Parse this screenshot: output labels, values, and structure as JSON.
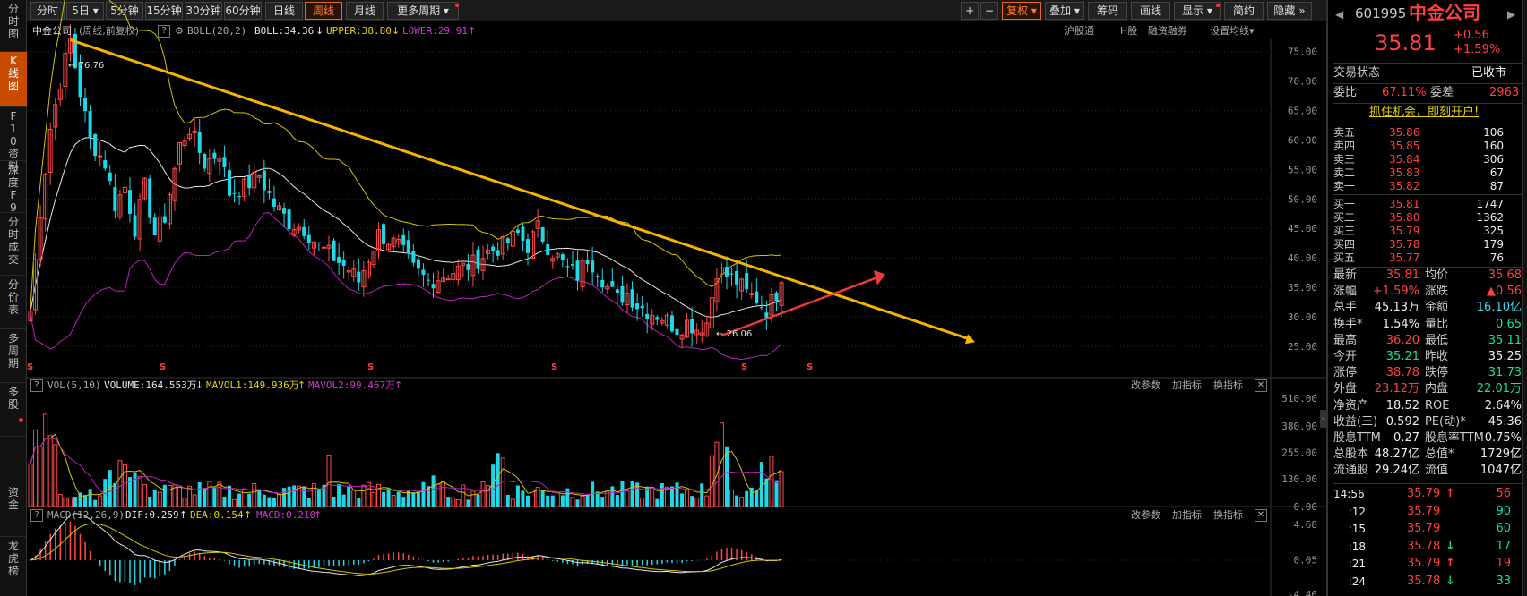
{
  "left_nav": {
    "items": [
      {
        "label": "分时图"
      },
      {
        "label": "K线图"
      },
      {
        "label": "F10资料"
      },
      {
        "label": "深度F9"
      },
      {
        "label": "分时成交"
      },
      {
        "label": "分价表"
      },
      {
        "label": "多周期"
      },
      {
        "label": "多股"
      },
      {
        "label": "资金"
      },
      {
        "label": "龙虎榜"
      }
    ],
    "active": "K线图"
  },
  "toolbar": {
    "periods": [
      "分时",
      "5日",
      "5分钟",
      "15分钟",
      "30分钟",
      "60分钟",
      "日线",
      "周线",
      "月线",
      "更多周期"
    ],
    "active_period": "周线",
    "right_buttons": {
      "plus": "+",
      "minus": "−",
      "fuquan": "复权",
      "overlay": "叠加",
      "chips": "筹码",
      "draw": "画线",
      "display": "显示",
      "simple": "简约",
      "hide": "隐藏"
    }
  },
  "kline_panel": {
    "stock_name": "中金公司",
    "period_note": "(周线,前复权)",
    "indicator": "BOLL(20,2)",
    "boll": "BOLL:34.36",
    "upper": "UPPER:38.80",
    "lower": "LOWER:29.91",
    "links": [
      "沪股通",
      "H股",
      "融资融券",
      "设置均线"
    ],
    "high_label": "76.76",
    "low_label": "26.06",
    "s_markers": [
      "S",
      "S",
      "S",
      "S",
      "S",
      "S"
    ],
    "y_ticks": [
      "75.00",
      "70.00",
      "65.00",
      "60.00",
      "55.00",
      "50.00",
      "45.00",
      "40.00",
      "35.00",
      "30.00",
      "25.00"
    ]
  },
  "vol_panel": {
    "title": "VOL(5,10)",
    "volume": "VOLUME:164.553万",
    "mavol1": "MAVOL1:149.936万",
    "mavol2": "MAVOL2:99.467万",
    "buttons": [
      "改参数",
      "加指标",
      "换指标"
    ],
    "y_ticks": [
      "510.00",
      "380.00",
      "255.00",
      "130.00",
      "0.00"
    ]
  },
  "macd_panel": {
    "title": "MACD(12,26,9)",
    "dif": "DIF:0.259",
    "dea": "DEA:0.154",
    "macd": "MACD:0.210",
    "buttons": [
      "改参数",
      "加指标",
      "换指标"
    ],
    "y_ticks": [
      "4.68",
      "0.05",
      "-4.46"
    ]
  },
  "quote": {
    "code": "601995",
    "name": "中金公司",
    "price": "35.81",
    "change": "+0.56",
    "change_pct": "+1.59%",
    "trade_state_label": "交易状态",
    "trade_state": "已收市",
    "weibi_label": "委比",
    "weibi": "67.11%",
    "weicha_label": "委差",
    "weicha": "2963",
    "promo": "抓住机会，即刻开户!",
    "asks": [
      {
        "label": "卖五",
        "price": "35.86",
        "vol": "106"
      },
      {
        "label": "卖四",
        "price": "35.85",
        "vol": "160"
      },
      {
        "label": "卖三",
        "price": "35.84",
        "vol": "306"
      },
      {
        "label": "卖二",
        "price": "35.83",
        "vol": "67"
      },
      {
        "label": "卖一",
        "price": "35.82",
        "vol": "87"
      }
    ],
    "bids": [
      {
        "label": "买一",
        "price": "35.81",
        "vol": "1747"
      },
      {
        "label": "买二",
        "price": "35.80",
        "vol": "1362"
      },
      {
        "label": "买三",
        "price": "35.79",
        "vol": "325"
      },
      {
        "label": "买四",
        "price": "35.78",
        "vol": "179"
      },
      {
        "label": "买五",
        "price": "35.77",
        "vol": "76"
      }
    ],
    "stats": [
      {
        "l1": "最新",
        "v1": "35.81",
        "c1": "red",
        "l2": "均价",
        "v2": "35.68",
        "c2": "red"
      },
      {
        "l1": "涨幅",
        "v1": "+1.59%",
        "c1": "red",
        "l2": "涨跌",
        "v2": "▲0.56",
        "c2": "red"
      },
      {
        "l1": "总手",
        "v1": "45.13万",
        "c1": "white",
        "l2": "金额",
        "v2": "16.10亿",
        "c2": "cyan"
      },
      {
        "l1": "换手*",
        "v1": "1.54%",
        "c1": "white",
        "l2": "量比",
        "v2": "0.65",
        "c2": "green"
      },
      {
        "l1": "最高",
        "v1": "36.20",
        "c1": "red",
        "l2": "最低",
        "v2": "35.11",
        "c2": "green"
      },
      {
        "l1": "今开",
        "v1": "35.21",
        "c1": "green",
        "l2": "昨收",
        "v2": "35.25",
        "c2": "white"
      },
      {
        "l1": "涨停",
        "v1": "38.78",
        "c1": "red",
        "l2": "跌停",
        "v2": "31.73",
        "c2": "green"
      },
      {
        "l1": "外盘",
        "v1": "23.12万",
        "c1": "red",
        "l2": "内盘",
        "v2": "22.01万",
        "c2": "green"
      },
      {
        "l1": "净资产",
        "v1": "18.52",
        "c1": "white",
        "l2": "ROE",
        "v2": "2.64%",
        "c2": "white"
      },
      {
        "l1": "收益(三)",
        "v1": "0.592",
        "c1": "white",
        "l2": "PE(动)*",
        "v2": "45.36",
        "c2": "white"
      },
      {
        "l1": "股息TTM",
        "v1": "0.27",
        "c1": "white",
        "l2": "股息率TTM",
        "v2": "0.75%",
        "c2": "white"
      },
      {
        "l1": "总股本",
        "v1": "48.27亿",
        "c1": "white",
        "l2": "总值*",
        "v2": "1729亿",
        "c2": "white"
      },
      {
        "l1": "流通股",
        "v1": "29.24亿",
        "c1": "white",
        "l2": "流值",
        "v2": "1047亿",
        "c2": "white"
      }
    ],
    "ticks": [
      {
        "time": "14:56",
        "price": "35.79",
        "arrow": "up",
        "vol": "56",
        "vcolor": "red"
      },
      {
        "time": ":12",
        "price": "35.79",
        "arrow": "",
        "vol": "90",
        "vcolor": "green"
      },
      {
        "time": ":15",
        "price": "35.79",
        "arrow": "",
        "vol": "60",
        "vcolor": "green"
      },
      {
        "time": ":18",
        "price": "35.78",
        "arrow": "down",
        "vol": "17",
        "vcolor": "green"
      },
      {
        "time": ":21",
        "price": "35.79",
        "arrow": "up",
        "vol": "19",
        "vcolor": "red"
      },
      {
        "time": ":24",
        "price": "35.78",
        "arrow": "down",
        "vol": "33",
        "vcolor": "green"
      }
    ]
  },
  "colors": {
    "up": "#ff4a4a",
    "down": "#1ed8e8",
    "boll_mid": "#e8e8e8",
    "boll_upper": "#d4c400",
    "boll_lower": "#c020c0",
    "trend_down": "#f4b400",
    "trend_up": "#ee3a3a",
    "accent": "#e5652a"
  },
  "chart_data": [
    {
      "type": "candlestick",
      "title": "中金公司 (周线,前复权)",
      "ylim": [
        23,
        78
      ],
      "series": [
        {
          "name": "BOLL",
          "last": 34.36
        },
        {
          "name": "UPPER",
          "last": 38.8
        },
        {
          "name": "LOWER",
          "last": 29.91
        }
      ],
      "high": 76.76,
      "low": 26.06,
      "last_close": 35.81
    },
    {
      "type": "bar",
      "title": "VOL(5,10)",
      "ylim": [
        0,
        510
      ],
      "series": [
        {
          "name": "VOLUME",
          "last": 164.553
        },
        {
          "name": "MAVOL1",
          "last": 149.936
        },
        {
          "name": "MAVOL2",
          "last": 99.467
        }
      ]
    },
    {
      "type": "bar",
      "title": "MACD(12,26,9)",
      "ylim": [
        -4.46,
        4.68
      ],
      "series": [
        {
          "name": "DIF",
          "last": 0.259
        },
        {
          "name": "DEA",
          "last": 0.154
        },
        {
          "name": "MACD",
          "last": 0.21
        }
      ]
    }
  ]
}
